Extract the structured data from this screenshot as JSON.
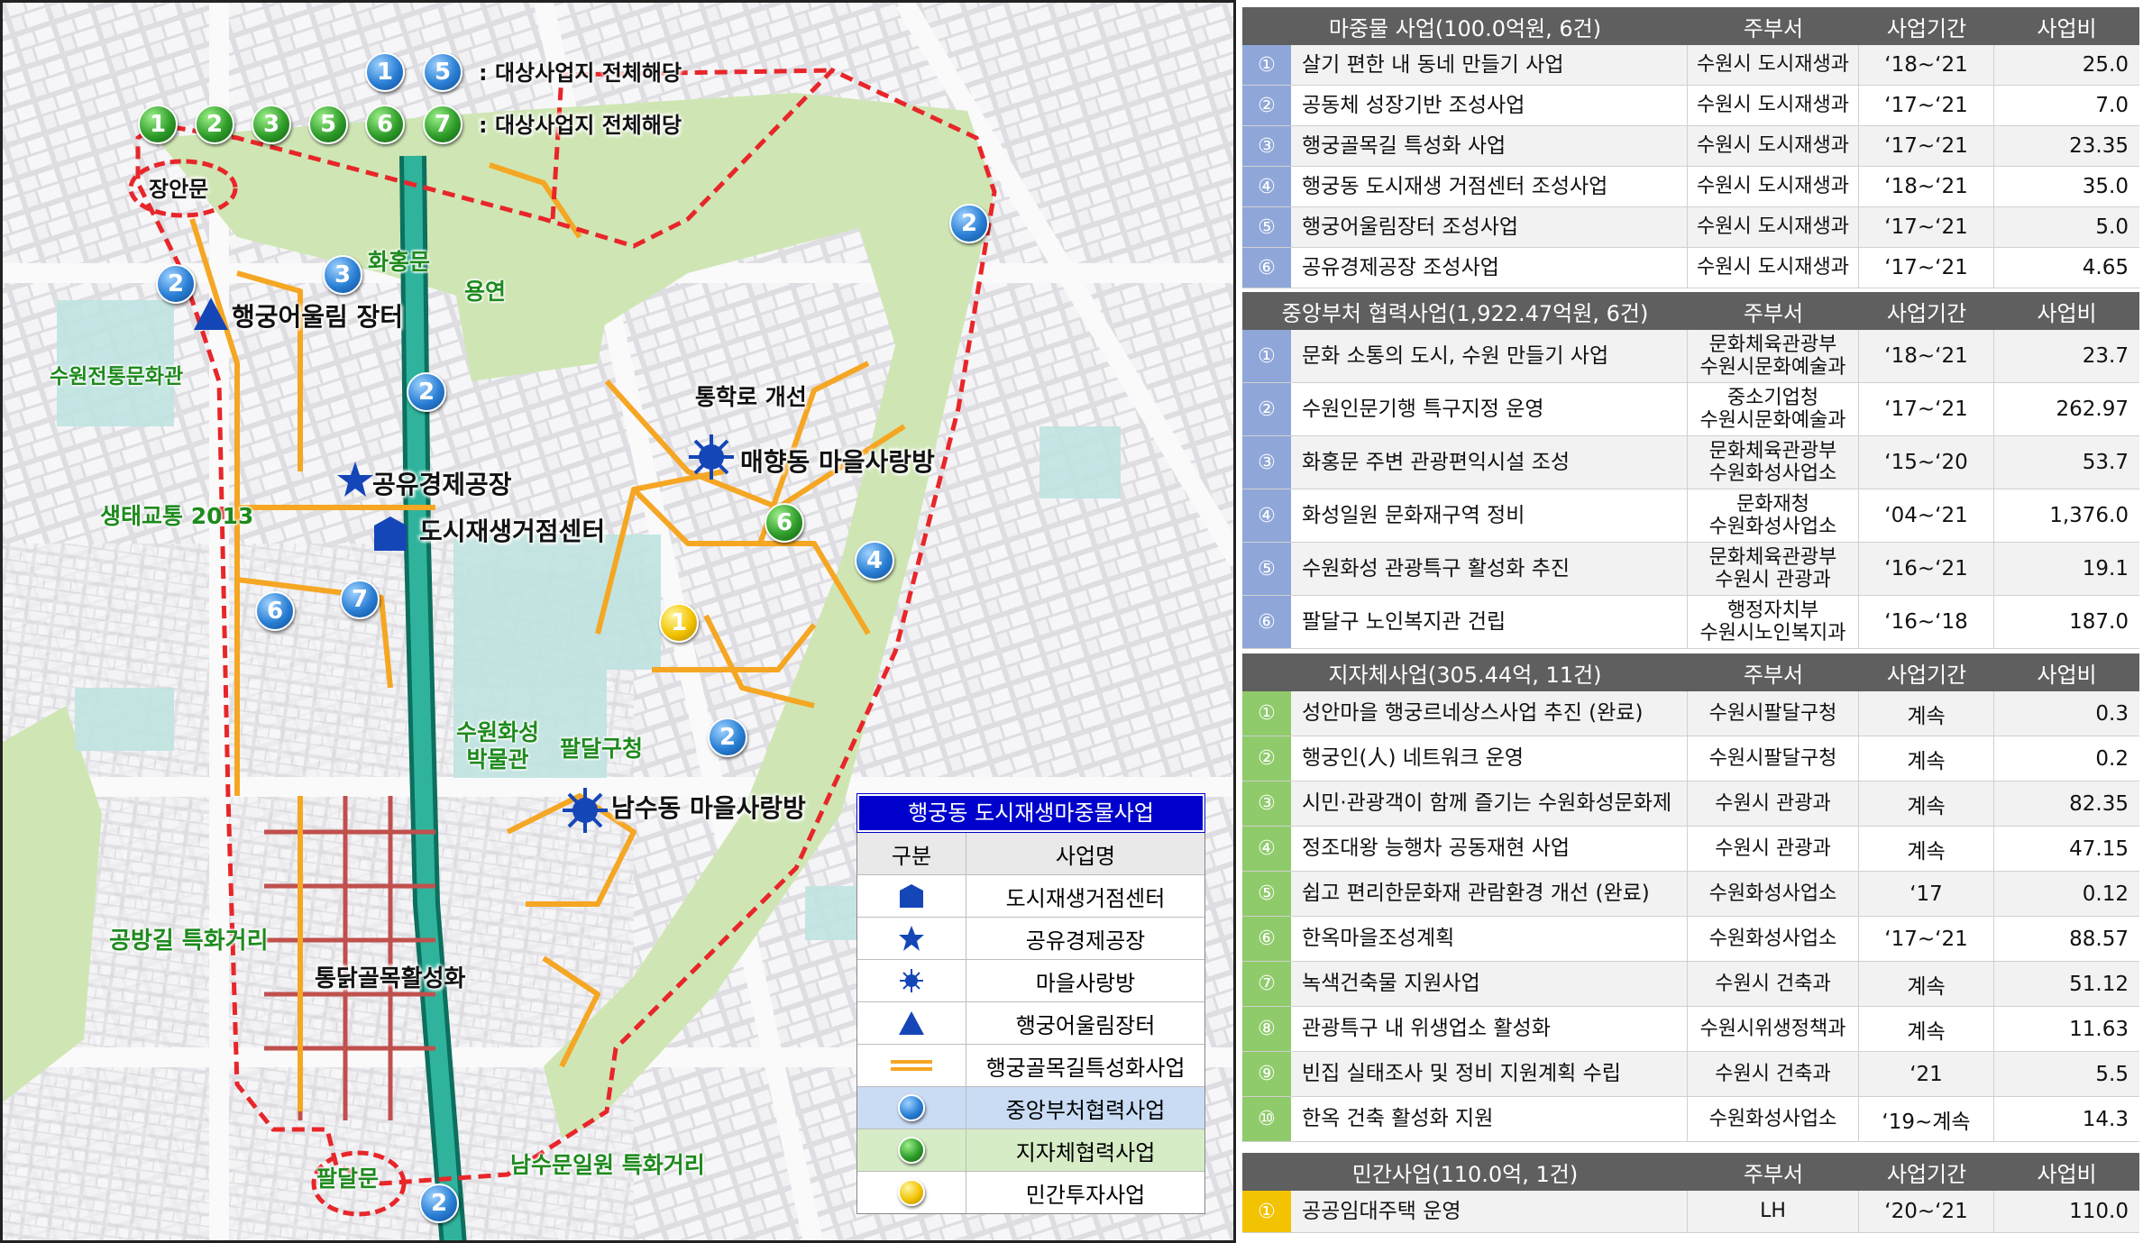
{
  "map": {
    "header_badges_a": {
      "numbers": [
        "1",
        "5"
      ],
      "text": ": 대상사업지 전체해당"
    },
    "header_badges_b": {
      "numbers": [
        "1",
        "2",
        "3",
        "4",
        "5",
        "6",
        "7"
      ],
      "text": ": 대상사업지 전체해당"
    },
    "place_labels": {
      "janganmun": "장안문",
      "hwahongmun": "화홍문",
      "yongyeon": "용연",
      "market": "행궁어울림 장터",
      "culture_hall": "수원전통문화관",
      "eco_2013": "생태교통 2013",
      "shared_factory": "공유경제공장",
      "regen_center": "도시재생거점센터",
      "school_road": "통학로 개선",
      "maehyang": "매향동 마을사랑방",
      "museum": "수원화성\n박물관",
      "paldal_office": "팔달구청",
      "namsu": "남수동 마을사랑방",
      "gongbang": "공방길 특화거리",
      "chicken_alley": "통닭골목활성화",
      "paldalmun": "팔달문",
      "namsumun": "남수문일원 특화거리"
    },
    "legend": {
      "title": "행궁동 도시재생마중물사업",
      "col_type": "구분",
      "col_name": "사업명",
      "items": [
        {
          "icon": "house-icon",
          "label": "도시재생거점센터"
        },
        {
          "icon": "star-icon",
          "label": "공유경제공장"
        },
        {
          "icon": "sun-icon",
          "label": "마을사랑방"
        },
        {
          "icon": "triangle-icon",
          "label": "행궁어울림장터"
        },
        {
          "icon": "orange-line-icon",
          "label": "행궁골목길특성화사업"
        },
        {
          "icon": "blue-ball-icon",
          "label": "중앙부처협력사업"
        },
        {
          "icon": "green-ball-icon",
          "label": "지자체협력사업"
        },
        {
          "icon": "yellow-ball-icon",
          "label": "민간투자사업"
        }
      ]
    },
    "colors": {
      "boundary": "#e8262a",
      "alley_route": "#f5a623",
      "chicken_grid": "#c0504d",
      "stream": "#1a9a8a",
      "park": "#cfe6b4"
    }
  },
  "tables": {
    "col_dept": "주부서",
    "col_period": "사업기간",
    "col_cost": "사업비",
    "seed": {
      "title": "마중물 사업(100.0억원, 6건)",
      "rows": [
        {
          "n": "①",
          "name": "살기 편한 내 동네 만들기 사업",
          "dept": "수원시 도시재생과",
          "period": "‘18~‘21",
          "cost": "25.0"
        },
        {
          "n": "②",
          "name": "공동체 성장기반 조성사업",
          "dept": "수원시 도시재생과",
          "period": "‘17~‘21",
          "cost": "7.0"
        },
        {
          "n": "③",
          "name": "행궁골목길 특성화 사업",
          "dept": "수원시 도시재생과",
          "period": "‘17~‘21",
          "cost": "23.35"
        },
        {
          "n": "④",
          "name": "행궁동 도시재생 거점센터 조성사업",
          "dept": "수원시 도시재생과",
          "period": "‘18~‘21",
          "cost": "35.0"
        },
        {
          "n": "⑤",
          "name": "행궁어울림장터 조성사업",
          "dept": "수원시 도시재생과",
          "period": "‘17~‘21",
          "cost": "5.0"
        },
        {
          "n": "⑥",
          "name": "공유경제공장 조성사업",
          "dept": "수원시 도시재생과",
          "period": "‘17~‘21",
          "cost": "4.65"
        }
      ]
    },
    "central": {
      "title": "중앙부처 협력사업(1,922.47억원, 6건)",
      "rows": [
        {
          "n": "①",
          "name": "문화 소통의 도시, 수원 만들기 사업",
          "dept1": "문화체육관광부",
          "dept2": "수원시문화예술과",
          "period": "‘18~‘21",
          "cost": "23.7"
        },
        {
          "n": "②",
          "name": "수원인문기행 특구지정 운영",
          "dept1": "중소기업청",
          "dept2": "수원시문화예술과",
          "period": "‘17~‘21",
          "cost": "262.97"
        },
        {
          "n": "③",
          "name": "화홍문 주변 관광편익시설 조성",
          "dept1": "문화체육관광부",
          "dept2": "수원화성사업소",
          "period": "‘15~‘20",
          "cost": "53.7"
        },
        {
          "n": "④",
          "name": "화성일원 문화재구역 정비",
          "dept1": "문화재청",
          "dept2": "수원화성사업소",
          "period": "‘04~‘21",
          "cost": "1,376.0"
        },
        {
          "n": "⑤",
          "name": "수원화성 관광특구 활성화 추진",
          "dept1": "문화체육관광부",
          "dept2": "수원시 관광과",
          "period": "‘16~‘21",
          "cost": "19.1"
        },
        {
          "n": "⑥",
          "name": "팔달구 노인복지관 건립",
          "dept1": "행정자치부",
          "dept2": "수원시노인복지과",
          "period": "‘16~‘18",
          "cost": "187.0"
        }
      ]
    },
    "local": {
      "title": "지자체사업(305.44억, 11건)",
      "rows": [
        {
          "n": "①",
          "name": "성안마을 행궁르네상스사업 추진 (완료)",
          "dept": "수원시팔달구청",
          "period": "계속",
          "cost": "0.3"
        },
        {
          "n": "②",
          "name": "행궁인(人) 네트워크 운영",
          "dept": "수원시팔달구청",
          "period": "계속",
          "cost": "0.2"
        },
        {
          "n": "③",
          "name": "시민·관광객이 함께 즐기는 수원화성문화제",
          "dept": "수원시 관광과",
          "period": "계속",
          "cost": "82.35"
        },
        {
          "n": "④",
          "name": "정조대왕 능행차 공동재현 사업",
          "dept": "수원시 관광과",
          "period": "계속",
          "cost": "47.15"
        },
        {
          "n": "⑤",
          "name": "쉽고 편리한문화재 관람환경 개선 (완료)",
          "dept": "수원화성사업소",
          "period": "‘17",
          "cost": "0.12"
        },
        {
          "n": "⑥",
          "name": "한옥마을조성계획",
          "dept": "수원화성사업소",
          "period": "‘17~‘21",
          "cost": "88.57"
        },
        {
          "n": "⑦",
          "name": "녹색건축물 지원사업",
          "dept": "수원시 건축과",
          "period": "계속",
          "cost": "51.12"
        },
        {
          "n": "⑧",
          "name": "관광특구 내 위생업소 활성화",
          "dept": "수원시위생정책과",
          "period": "계속",
          "cost": "11.63"
        },
        {
          "n": "⑨",
          "name": "빈집 실태조사 및 정비 지원계획 수립",
          "dept": "수원시 건축과",
          "period": "‘21",
          "cost": "5.5"
        },
        {
          "n": "⑩",
          "name": "한옥 건축 활성화 지원",
          "dept": "수원화성사업소",
          "period": "‘19~계속",
          "cost": "14.3"
        }
      ]
    },
    "private": {
      "title": "민간사업(110.0억, 1건)",
      "rows": [
        {
          "n": "①",
          "name": "공공임대주택 운영",
          "dept": "LH",
          "period": "‘20~‘21",
          "cost": "110.0"
        }
      ]
    }
  }
}
